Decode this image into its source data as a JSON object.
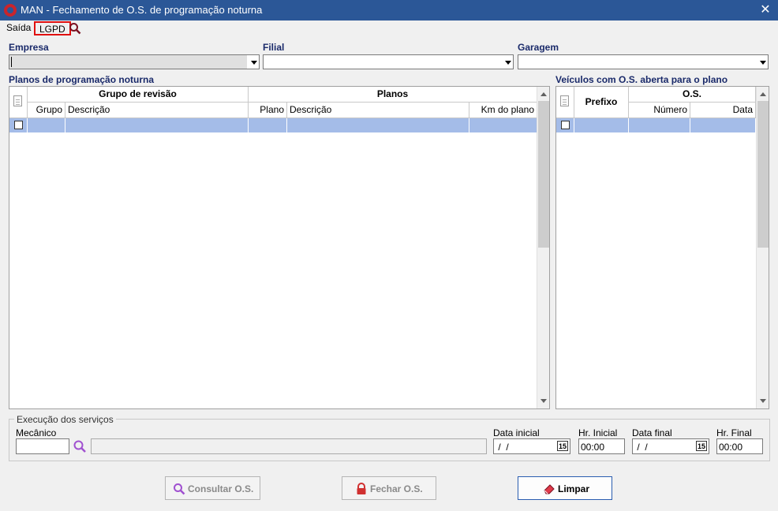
{
  "window": {
    "title": "MAN - Fechamento de O.S. de programação noturna",
    "close_glyph": "✕"
  },
  "menu": {
    "saida": "Saída",
    "lgpd": "LGPD",
    "search_icon": "search-icon"
  },
  "filters": {
    "empresa_label": "Empresa",
    "empresa_value": "",
    "filial_label": "Filial",
    "filial_value": "",
    "garagem_label": "Garagem",
    "garagem_value": ""
  },
  "planos": {
    "title": "Planos de programação noturna",
    "group_revisao": "Grupo de revisão",
    "group_planos": "Planos",
    "columns": {
      "grupo": "Grupo",
      "descricao": "Descrição",
      "plano": "Plano",
      "descricao2": "Descrição",
      "km": "Km do plano"
    }
  },
  "veiculos": {
    "title": "Veículos com O.S. aberta para o plano",
    "prefixo": "Prefixo",
    "group_os": "O.S.",
    "columns": {
      "numero": "Número",
      "data": "Data"
    }
  },
  "execucao": {
    "legend": "Execução dos serviços",
    "mecanico_label": "Mecânico",
    "mecanico_value": "",
    "mecanico_desc": "",
    "data_inicial_label": "Data inicial",
    "data_inicial_value": " /  /",
    "hr_inicial_label": "Hr. Inicial",
    "hr_inicial_value": "00:00",
    "data_final_label": "Data final",
    "data_final_value": " /  /",
    "hr_final_label": "Hr. Final",
    "hr_final_value": "00:00",
    "calendar_day": "15"
  },
  "actions": {
    "consultar": "Consultar O.S.",
    "fechar": "Fechar O.S.",
    "limpar": "Limpar"
  },
  "colors": {
    "titlebar": "#2b5797",
    "selection": "#a4bce8",
    "label": "#1a2a6a",
    "lgpd_border": "#e01010"
  }
}
